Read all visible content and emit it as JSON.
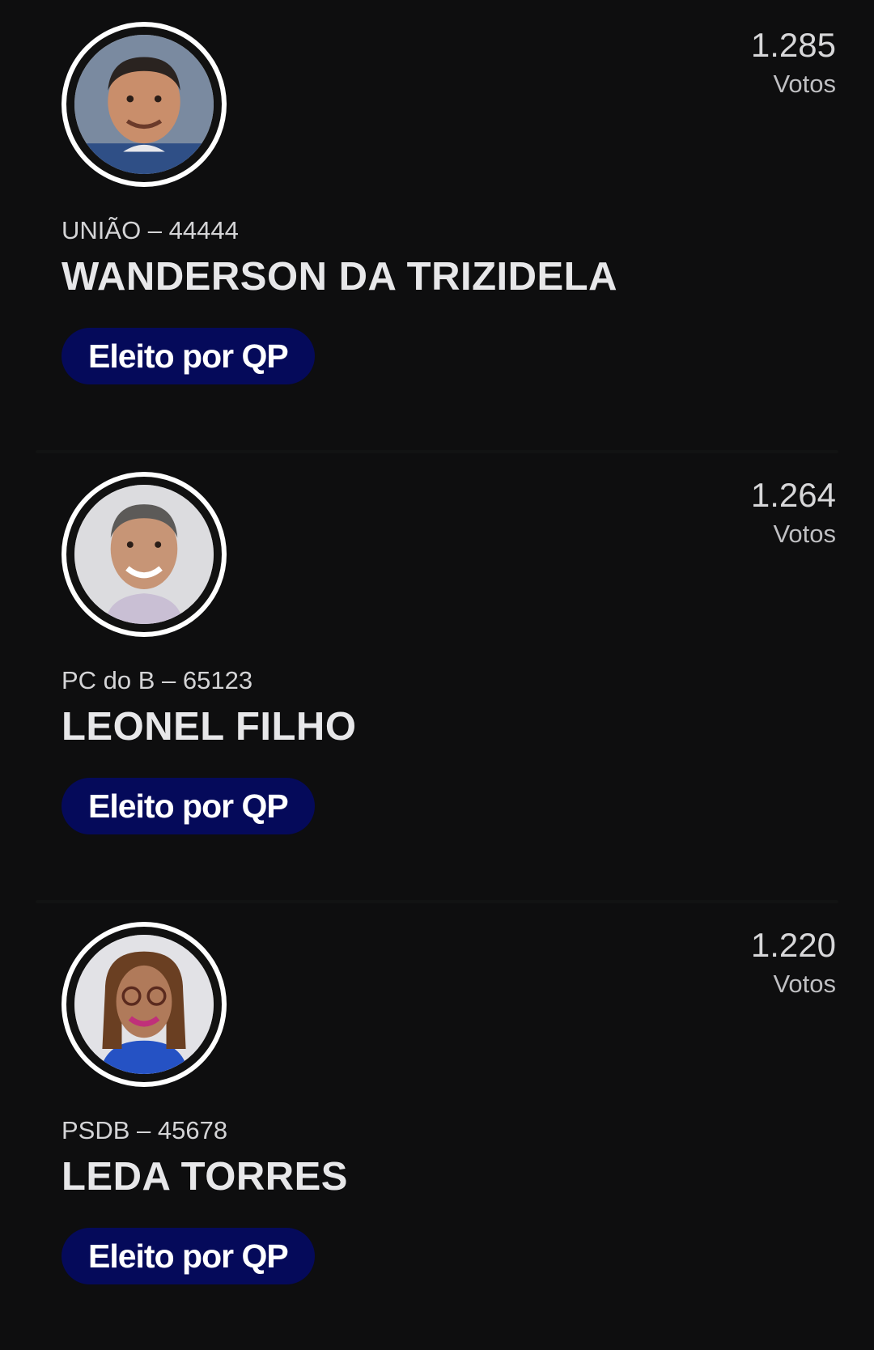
{
  "candidates": [
    {
      "party_number": "UNIÃO – 44444",
      "name": "WANDERSON DA TRIZIDELA",
      "votes": "1.285",
      "votes_label": "Votos",
      "status": "Eleito por QP",
      "photo_icon": "candidate-photo"
    },
    {
      "party_number": "PC do B – 65123",
      "name": "LEONEL FILHO",
      "votes": "1.264",
      "votes_label": "Votos",
      "status": "Eleito por QP",
      "photo_icon": "candidate-photo"
    },
    {
      "party_number": "PSDB – 45678",
      "name": "LEDA TORRES",
      "votes": "1.220",
      "votes_label": "Votos",
      "status": "Eleito por QP",
      "photo_icon": "candidate-photo"
    }
  ],
  "colors": {
    "background": "#0e0e0f",
    "badge": "#050a5a",
    "avatar_ring": "#ffffff"
  }
}
